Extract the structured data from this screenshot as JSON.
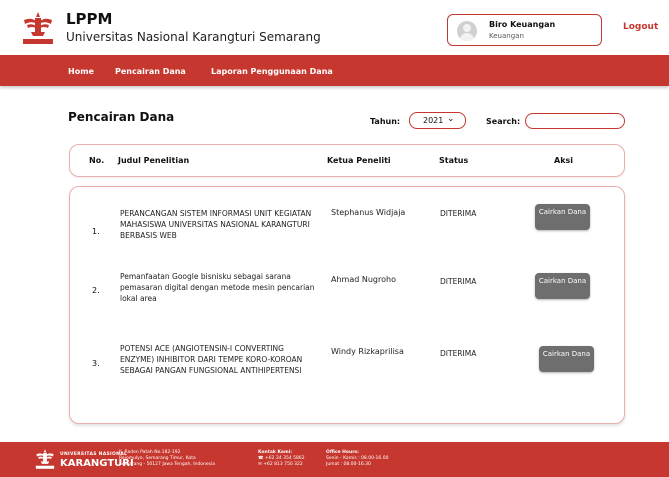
{
  "header": {
    "title": "LPPM",
    "subtitle": "Universitas Nasional Karangturi Semarang",
    "user_name": "Biro Keuangan",
    "user_role": "Keuangan",
    "logout": "Logout"
  },
  "nav": {
    "items": [
      "Home",
      "Pencairan Dana",
      "Laporan Penggunaan Dana"
    ]
  },
  "page": {
    "title": "Pencairan Dana",
    "tahun_label": "Tahun:",
    "tahun_value": "2021",
    "search_label": "Search:",
    "search_value": ""
  },
  "table": {
    "headers": {
      "no": "No.",
      "judul": "Judul Penelitian",
      "ketua": "Ketua Peneliti",
      "status": "Status",
      "aksi": "Aksi"
    },
    "rows": [
      {
        "no": "1.",
        "title": "PERANCANGAN SISTEM INFORMASI UNIT KEGIATAN MAHASISWA UNIVERSITAS NASIONAL KARANGTURI BERBASIS WEB",
        "ketua": "Stephanus Widjaja",
        "status": "DITERIMA",
        "action": "Cairkan Dana"
      },
      {
        "no": "2.",
        "title": "Pemanfaatan Google bisnisku sebagai sarana pemasaran digital dengan metode mesin pencarian lokal area",
        "ketua": "Ahmad Nugroho",
        "status": "DITERIMA",
        "action": "Cairkan Dana"
      },
      {
        "no": "3.",
        "title": "POTENSI ACE (ANGIOTENSIN-I CONVERTING ENZYME) INHIBITOR DARI TEMPE KORO-KOROAN SEBAGAI PANGAN FUNGSIONAL ANTIHIPERTENSI",
        "ketua": "Windy Rizkaprilisa",
        "status": "DITERIMA",
        "action": "Cairkan Dana"
      }
    ]
  },
  "footer": {
    "uni_line1": "UNIVERSITAS NASIONAL",
    "uni_line2": "KARANGTURI",
    "address": [
      "Jl. Raden Patah No.182-192",
      "Rejomulyo, Semarang Timur, Kota",
      "Semarang - 50127 Jawa Tengah, Indonesia"
    ],
    "contact_title": "Kontak Kami:",
    "contact": [
      "☎ +62 24 354 5862",
      "✉ +62 813 750 322"
    ],
    "hours_title": "Office Hours:",
    "hours": [
      "Senin - Kamis : 08.00-16.00",
      "Jumat : 08.00-16.30"
    ]
  },
  "colors": {
    "brand_red": "#c6372f",
    "button_gray": "#6e6e6e"
  }
}
